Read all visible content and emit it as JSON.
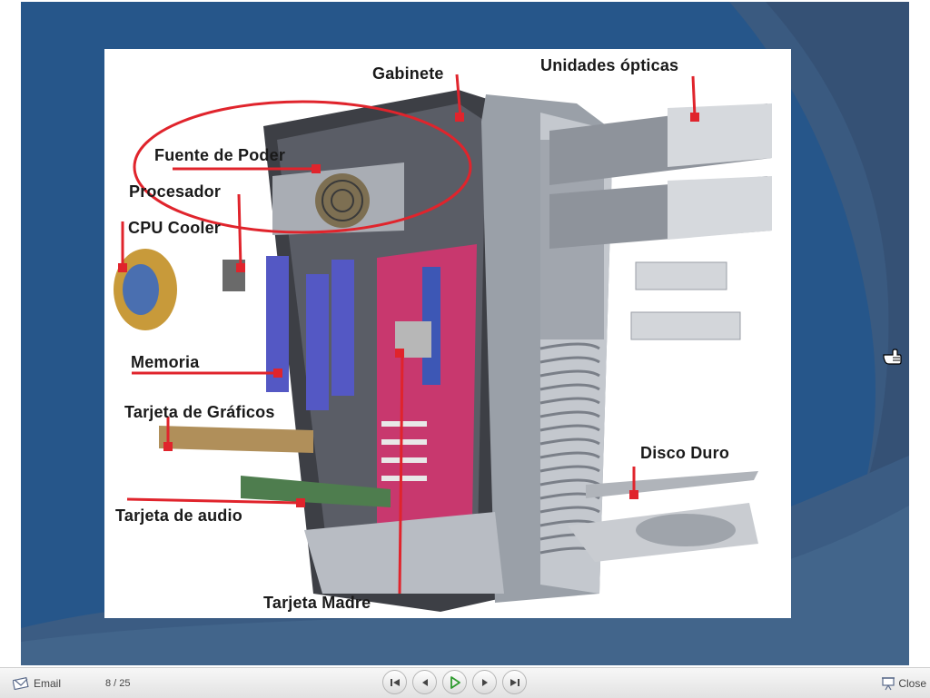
{
  "slide": {
    "labels": {
      "gabinete": "Gabinete",
      "unidades_opticas": "Unidades ópticas",
      "fuente_de_poder": "Fuente de Poder",
      "procesador": "Procesador",
      "cpu_cooler": "CPU Cooler",
      "memoria": "Memoria",
      "tarjeta_de_graficos": "Tarjeta de Gráficos",
      "tarjeta_de_audio": "Tarjeta de audio",
      "tarjeta_madre": "Tarjeta Madre",
      "disco_duro": "Disco Duro"
    },
    "colors": {
      "background": "#2a5a8e",
      "background_dark": "#1e4a7c",
      "swirl": "#3b5f86",
      "highlight_ellipse": "#e0242c",
      "leader_line": "#e0242c",
      "motherboard": "#c8386e"
    }
  },
  "player": {
    "email_label": "Email",
    "email_icon": "envelope-icon",
    "page_counter": "8 / 25",
    "controls": [
      {
        "name": "first-slide-button",
        "icon": "skip-to-start-icon"
      },
      {
        "name": "previous-slide-button",
        "icon": "previous-icon"
      },
      {
        "name": "play-button",
        "icon": "play-icon"
      },
      {
        "name": "next-slide-button",
        "icon": "next-icon"
      },
      {
        "name": "last-slide-button",
        "icon": "skip-to-end-icon"
      }
    ],
    "close_label": "Close",
    "close_icon": "presentation-icon",
    "colors": {
      "play": "#2e9b2e",
      "icons": "#444444"
    }
  }
}
